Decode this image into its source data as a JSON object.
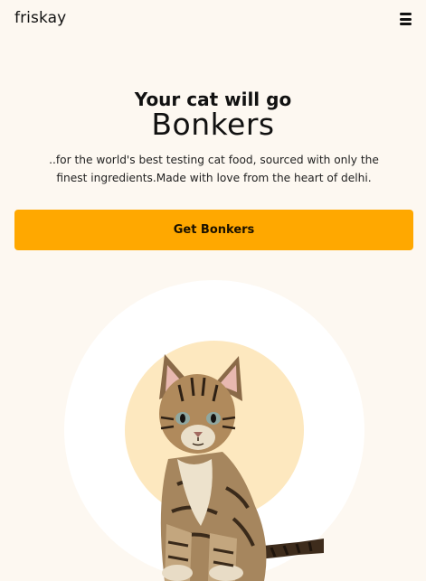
{
  "nav": {
    "logo": "friskay",
    "menu_icon": "hamburger-menu-icon"
  },
  "hero": {
    "heading": "Your cat will go",
    "highlight": "Bonkers",
    "subtitle": "..for the world's best testing cat food, sourced with only the finest ingredients.Made with love from the heart of delhi.",
    "cta_label": "Get Bonkers"
  },
  "colors": {
    "background": "#fdf8f1",
    "accent": "#ffa800",
    "outer_circle": "#ffffff",
    "inner_circle": "#fde8bf"
  }
}
